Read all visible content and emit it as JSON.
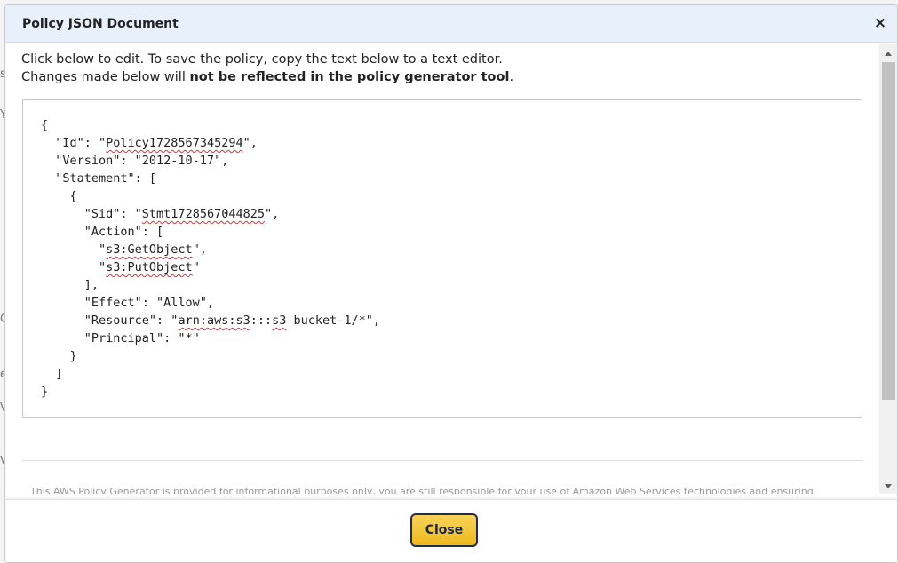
{
  "modal": {
    "title": "Policy JSON Document",
    "close_icon": "×",
    "intro_line1": "Click below to edit. To save the policy, copy the text below to a text editor.",
    "intro_line2_prefix": "Changes made below will ",
    "intro_line2_bold": "not be reflected in the policy generator tool",
    "intro_line2_suffix": ".",
    "footer_cutoff": "This AWS Policy Generator is provided for informational purposes only, you are still responsible for your use of Amazon Web Services technologies and ensuring",
    "close_button_label": "Close"
  },
  "policy": {
    "l01": "{",
    "l02_a": "  \"Id\": \"",
    "l02_b": "Policy1728567345294",
    "l02_c": "\",",
    "l03": "  \"Version\": \"2012-10-17\",",
    "l04": "  \"Statement\": [",
    "l05": "    {",
    "l06_a": "      \"Sid\": \"",
    "l06_b": "Stmt1728567044825",
    "l06_c": "\",",
    "l07": "      \"Action\": [",
    "l08_a": "        \"",
    "l08_b": "s3:GetObject",
    "l08_c": "\",",
    "l09_a": "        \"",
    "l09_b": "s3:PutObject",
    "l09_c": "\"",
    "l10": "      ],",
    "l11": "      \"Effect\": \"Allow\",",
    "l12_a": "      \"Resource\": \"",
    "l12_b": "arn:aws:s3",
    "l12_c": ":::",
    "l12_d": "s3",
    "l12_e": "-bucket-1/*\",",
    "l13": "      \"Principal\": \"*\"",
    "l14": "    }",
    "l15": "  ]",
    "l16": "}"
  },
  "background": {
    "chars": [
      "s",
      "Y",
      "C",
      "e",
      "V",
      "V"
    ]
  },
  "colors": {
    "header_bg": "#e8f1fb",
    "close_button_bg": "#efb81e",
    "close_button_border": "#222d48",
    "spell_underline": "#d33"
  }
}
